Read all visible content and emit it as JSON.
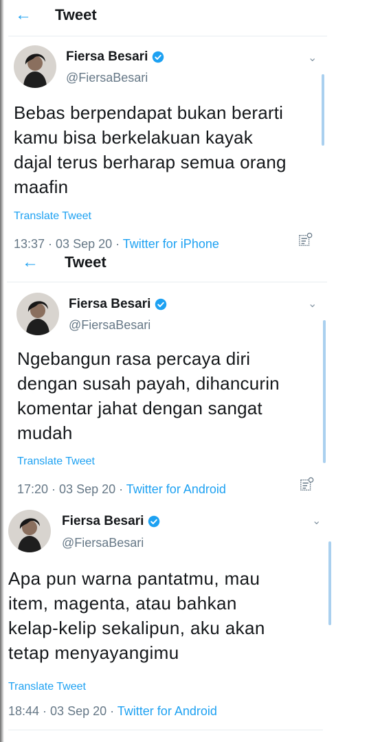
{
  "screens": [
    {
      "header_title": "Tweet",
      "name": "Fiersa Besari",
      "handle": "@FiersaBesari",
      "text_lines": [
        "Bebas berpendapat bukan berarti",
        "kamu bisa berkelakuan kayak",
        "dajal terus berharap semua orang",
        "maafin"
      ],
      "translate": "Translate Tweet",
      "time": "13:37 · 03 Sep 20 · ",
      "source": "Twitter for iPhone"
    },
    {
      "header_title": "Tweet",
      "name": "Fiersa Besari",
      "handle": "@FiersaBesari",
      "text_lines": [
        "Ngebangun rasa percaya diri",
        "dengan susah payah, dihancurin",
        "komentar jahat dengan sangat",
        "mudah"
      ],
      "translate": "Translate Tweet",
      "time": "17:20 · 03 Sep 20 · ",
      "source": "Twitter for Android"
    },
    {
      "name": "Fiersa Besari",
      "handle": "@FiersaBesari",
      "text_lines": [
        "Apa pun warna pantatmu, mau",
        "item, magenta, atau bahkan",
        "kelap-kelip sekalipun, aku akan",
        "tetap menyayangimu"
      ],
      "translate": "Translate Tweet",
      "time": "18:44 · 03 Sep 20 · ",
      "source": "Twitter for Android"
    }
  ],
  "icons": {
    "back": "arrow-left-icon",
    "verified": "verified-badge-icon",
    "more": "chevron-down-icon",
    "analytics": "tweet-analytics-icon"
  },
  "colors": {
    "accent": "#1da1f2",
    "secondary_text": "#657786",
    "primary_text": "#14171a"
  }
}
